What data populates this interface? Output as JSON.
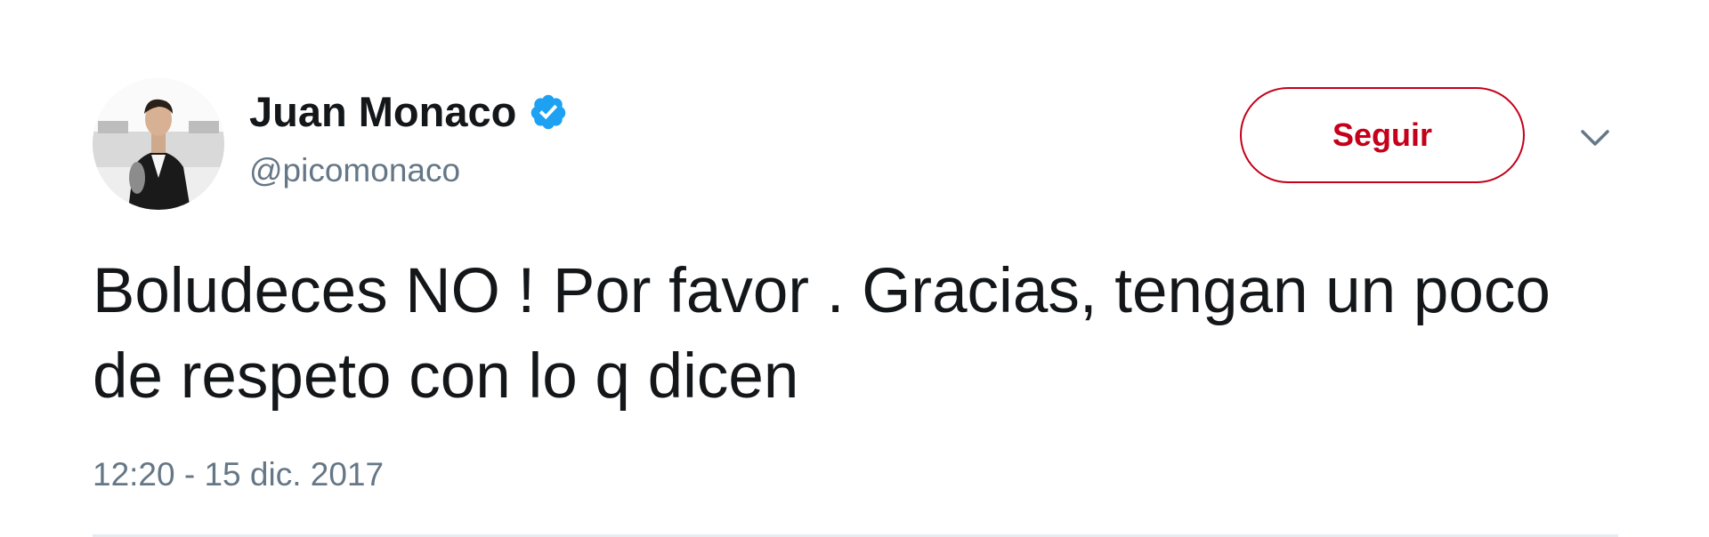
{
  "author": {
    "display_name": "Juan Monaco",
    "handle": "@picomonaco",
    "verified": true,
    "avatar_icon": "profile-photo"
  },
  "actions": {
    "follow_label": "Seguir",
    "more_icon": "chevron-down-icon"
  },
  "tweet": {
    "text": "Boludeces NO ! Por favor . Gracias, tengan un poco de respeto con lo q dicen",
    "timestamp": "12:20 - 15 dic. 2017"
  },
  "colors": {
    "follow_accent": "#c4001a",
    "verified_blue": "#1da1f2",
    "secondary_text": "#657786",
    "primary_text": "#14171a",
    "divider": "#e6ecf0"
  }
}
